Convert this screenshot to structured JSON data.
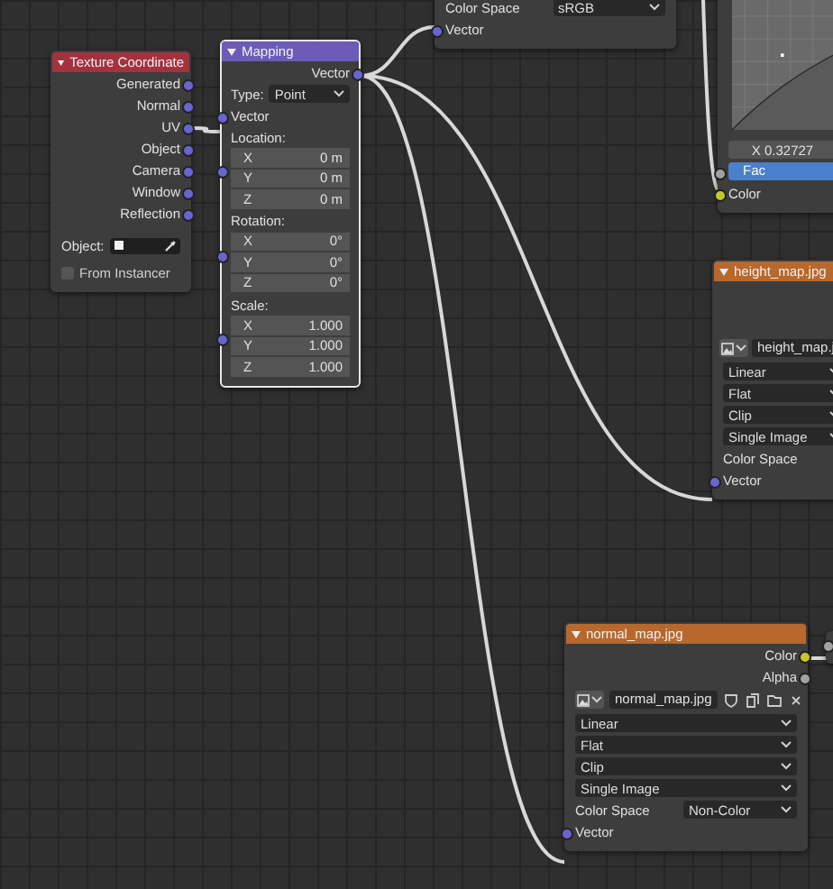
{
  "nodes": [
    {
      "title": "Texture Coordinate",
      "color": "#a3323f",
      "rows": [
        {
          "kind": "output",
          "label": "Generated",
          "color": "#6a63d0"
        },
        {
          "kind": "output",
          "label": "Normal",
          "color": "#6a63d0"
        },
        {
          "kind": "output",
          "label": "UV",
          "color": "#6a63d0"
        },
        {
          "kind": "output",
          "label": "Object",
          "color": "#6a63d0"
        },
        {
          "kind": "output",
          "label": "Camera",
          "color": "#6a63d0"
        },
        {
          "kind": "output",
          "label": "Window",
          "color": "#6a63d0"
        },
        {
          "kind": "output",
          "label": "Reflection",
          "color": "#6a63d0"
        },
        {
          "kind": "object",
          "label": "Object:"
        },
        {
          "kind": "checkbox",
          "label": "From Instancer",
          "checked": false
        }
      ]
    },
    {
      "title": "Mapping",
      "color": "#6c5bb8",
      "selected": true,
      "rows": [
        {
          "kind": "output",
          "label": "Vector",
          "color": "#6a63d0"
        },
        {
          "kind": "dropdown",
          "label": "Type:",
          "value": "Point"
        },
        {
          "kind": "input",
          "label": "Vector",
          "color": "#6a63d0"
        },
        {
          "kind": "vector",
          "label": "Location:",
          "color": "#6a63d0",
          "fields": [
            {
              "axis": "X",
              "value": "0 m"
            },
            {
              "axis": "Y",
              "value": "0 m"
            },
            {
              "axis": "Z",
              "value": "0 m"
            }
          ]
        },
        {
          "kind": "vector",
          "label": "Rotation:",
          "color": "#6a63d0",
          "fields": [
            {
              "axis": "X",
              "value": "0°"
            },
            {
              "axis": "Y",
              "value": "0°"
            },
            {
              "axis": "Z",
              "value": "0°"
            }
          ]
        },
        {
          "kind": "vector",
          "label": "Scale:",
          "color": "#6a63d0",
          "fields": [
            {
              "axis": "X",
              "value": "1.000"
            },
            {
              "axis": "Y",
              "value": "1.000"
            },
            {
              "axis": "Z",
              "value": "1.000"
            }
          ]
        }
      ]
    },
    {
      "rows": [
        {
          "kind": "prop",
          "label": "Color Space",
          "value": "sRGB"
        },
        {
          "kind": "input",
          "label": "Vector",
          "color": "#6a63d0"
        }
      ]
    },
    {
      "rows": [
        {
          "kind": "curve"
        },
        {
          "kind": "reading",
          "value": "X 0.32727"
        },
        {
          "kind": "slider",
          "label": "Fac",
          "color": "#a1a1a1",
          "level": 1
        },
        {
          "kind": "input",
          "label": "Color",
          "color": "#c7c729"
        }
      ]
    },
    {
      "title": "height_map.jpg",
      "color": "#b8682c",
      "rows": [
        {
          "kind": "spacer"
        },
        {
          "kind": "image",
          "value": "height_map.j"
        },
        {
          "kind": "select",
          "value": "Linear"
        },
        {
          "kind": "select",
          "value": "Flat"
        },
        {
          "kind": "select",
          "value": "Clip"
        },
        {
          "kind": "select",
          "value": "Single Image"
        },
        {
          "kind": "prop",
          "label": "Color Space"
        },
        {
          "kind": "input",
          "label": "Vector",
          "color": "#6a63d0"
        }
      ]
    },
    {
      "title": "normal_map.jpg",
      "color": "#b8682c",
      "rows": [
        {
          "kind": "output",
          "label": "Color",
          "color": "#c7c729"
        },
        {
          "kind": "output",
          "label": "Alpha",
          "color": "#a1a1a1"
        },
        {
          "kind": "image",
          "value": "normal_map.jpg",
          "actions": true
        },
        {
          "kind": "select",
          "value": "Linear"
        },
        {
          "kind": "select",
          "value": "Flat"
        },
        {
          "kind": "select",
          "value": "Clip"
        },
        {
          "kind": "select",
          "value": "Single Image"
        },
        {
          "kind": "prop",
          "label": "Color Space",
          "value": "Non-Color"
        },
        {
          "kind": "input",
          "label": "Vector",
          "color": "#6a63d0"
        }
      ]
    },
    {
      "rows": [
        {
          "kind": "input",
          "color": "#a1a1a1"
        }
      ]
    }
  ]
}
